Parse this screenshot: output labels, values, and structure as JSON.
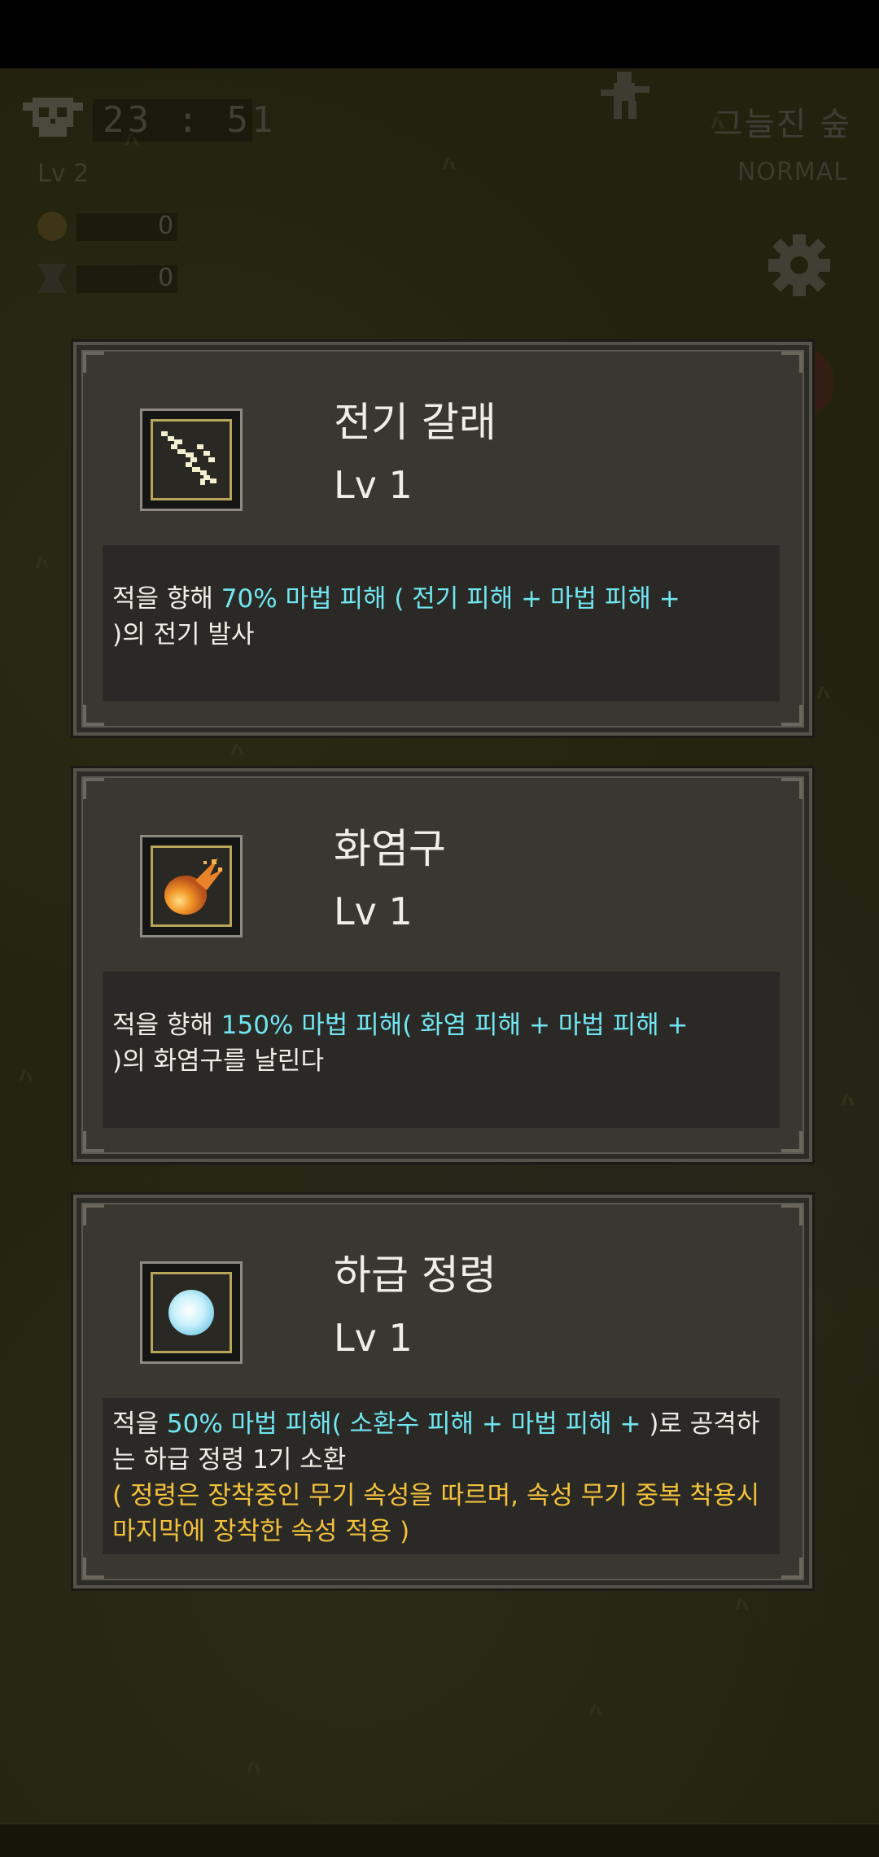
{
  "hud": {
    "timer": "23 : 51",
    "level": "Lv 2",
    "coins": "0",
    "gems": "0",
    "stage_name": "그늘진 숲",
    "difficulty": "NORMAL"
  },
  "cards": [
    {
      "name": "전기 갈래",
      "level": "Lv 1",
      "icon": "lightning-icon",
      "desc": {
        "pre": "적을 향해 ",
        "highlight": "70% 마법 피해 ( 전기 피해 + 마법 피해 +",
        "post": ")의 전기 발사"
      }
    },
    {
      "name": "화염구",
      "level": "Lv 1",
      "icon": "fireball-icon",
      "desc": {
        "pre": "적을 향해 ",
        "highlight": "150% 마법 피해( 화염 피해 + 마법 피해 +",
        "post": ")의 화염구를 날린다"
      }
    },
    {
      "name": "하급 정령",
      "level": "Lv 1",
      "icon": "spirit-orb-icon",
      "desc": {
        "pre": "적을 ",
        "highlight": "50% 마법 피해( 소환수 피해 + 마법 피해 + ",
        "post": ")로 공격하는 하급 정령 1기 소환",
        "note": "( 정령은 장착중인 무기 속성을 따르며, 속성 무기 중복 착용시 마지막에 장착한 속성 적용 )"
      }
    }
  ],
  "colors": {
    "highlight": "#6fe6f2",
    "note": "#f2c23a",
    "card_bg": "#3a3731"
  }
}
